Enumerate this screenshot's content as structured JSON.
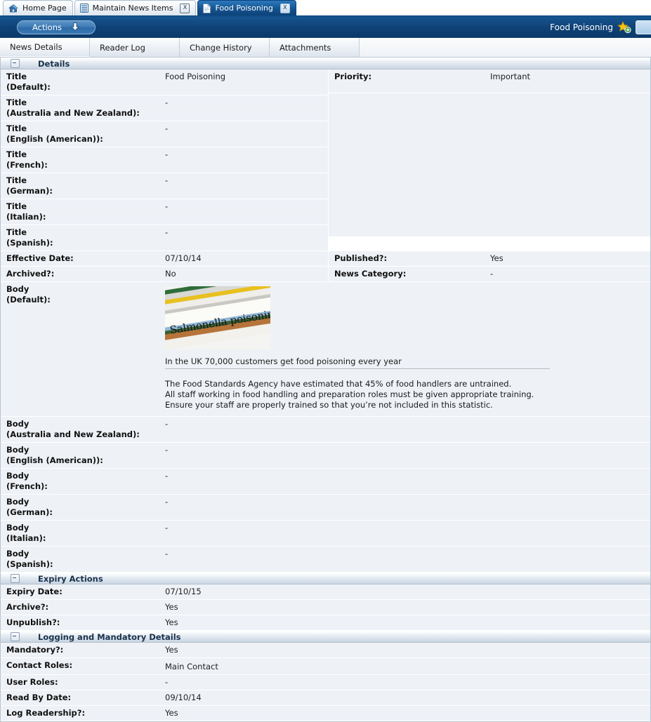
{
  "browser_tabs": [
    {
      "label": "Home Page",
      "icon": "home-icon",
      "active": false,
      "closable": false
    },
    {
      "label": "Maintain News Items",
      "icon": "grid-icon",
      "active": false,
      "closable": true,
      "close_label": "X"
    },
    {
      "label": "Food Poisoning",
      "icon": "document-icon",
      "active": true,
      "closable": true,
      "close_label": "X"
    }
  ],
  "actionbar": {
    "actions_label": "Actions",
    "dropdown_icon": "arrow-down-icon",
    "title": "Food Poisoning",
    "favorite_icon": "star-add-icon",
    "panel_icon": "panel-icon"
  },
  "page_tabs": [
    {
      "label": "News Details",
      "active": true
    },
    {
      "label": "Reader Log",
      "active": false
    },
    {
      "label": "Change History",
      "active": false
    },
    {
      "label": "Attachments",
      "active": false
    }
  ],
  "sections": {
    "details": {
      "title": "Details",
      "collapse_icon": "collapse-minus-icon",
      "left_rows": [
        {
          "label": "Title",
          "sub": "(Default):",
          "value": "Food Poisoning"
        },
        {
          "label": "Title",
          "sub": "(Australia and New Zealand):",
          "value": "-"
        },
        {
          "label": "Title",
          "sub": "(English (American)):",
          "value": "-"
        },
        {
          "label": "Title",
          "sub": "(French):",
          "value": "-"
        },
        {
          "label": "Title",
          "sub": "(German):",
          "value": "-"
        },
        {
          "label": "Title",
          "sub": "(Italian):",
          "value": "-"
        },
        {
          "label": "Title",
          "sub": "(Spanish):",
          "value": "-"
        }
      ],
      "right_rows": [
        {
          "label": "Priority:",
          "sub": "",
          "value": "Important"
        }
      ],
      "date_rows_left": [
        {
          "label": "Effective Date:",
          "sub": "",
          "value": "07/10/14"
        },
        {
          "label": "Archived?:",
          "sub": "",
          "value": "No"
        }
      ],
      "date_rows_right": [
        {
          "label": "Published?:",
          "sub": "",
          "value": "Yes"
        },
        {
          "label": "News Category:",
          "sub": "",
          "value": "-"
        }
      ],
      "body_default": {
        "label": "Body",
        "sub": "(Default):",
        "image_alt": "Salmonella poisoning",
        "image_headline_text": "Salmonella poisoning",
        "headline": "In the UK 70,000 customers get food poisoning every year",
        "paragraph_lines": [
          "The Food Standards Agency have estimated that 45% of food handlers are untrained.",
          "All staff working in food handling and preparation roles must be given appropriate training.",
          "Ensure your staff are properly trained so that you’re not included in this statistic."
        ]
      },
      "body_rows": [
        {
          "label": "Body",
          "sub": "(Australia and New Zealand):",
          "value": "-"
        },
        {
          "label": "Body",
          "sub": "(English (American)):",
          "value": "-"
        },
        {
          "label": "Body",
          "sub": "(French):",
          "value": "-"
        },
        {
          "label": "Body",
          "sub": "(German):",
          "value": "-"
        },
        {
          "label": "Body",
          "sub": "(Italian):",
          "value": "-"
        },
        {
          "label": "Body",
          "sub": "(Spanish):",
          "value": "-"
        }
      ]
    },
    "expiry": {
      "title": "Expiry Actions",
      "collapse_icon": "collapse-minus-icon",
      "rows": [
        {
          "label": "Expiry Date:",
          "sub": "",
          "value": "07/10/15"
        },
        {
          "label": "Archive?:",
          "sub": "",
          "value": "Yes"
        },
        {
          "label": "Unpublish?:",
          "sub": "",
          "value": "Yes"
        }
      ]
    },
    "logging": {
      "title": "Logging and Mandatory Details",
      "collapse_icon": "collapse-minus-icon",
      "rows": [
        {
          "label": "Mandatory?:",
          "sub": "",
          "value": "Yes"
        },
        {
          "label": "Contact Roles:",
          "sub": "",
          "value": "Main Contact"
        },
        {
          "label": "User Roles:",
          "sub": "",
          "value": "-"
        },
        {
          "label": "Read By Date:",
          "sub": "",
          "value": "09/10/14"
        },
        {
          "label": "Log Readership?:",
          "sub": "",
          "value": "Yes"
        }
      ]
    }
  },
  "colors": {
    "header_blue": "#0e4277",
    "active_tab_blue": "#15538f",
    "row_bg": "#eef1f6",
    "section_head_bg": "#c9d5e2",
    "star_yellow": "#f2c31a",
    "badge_green": "#3f9b35"
  }
}
